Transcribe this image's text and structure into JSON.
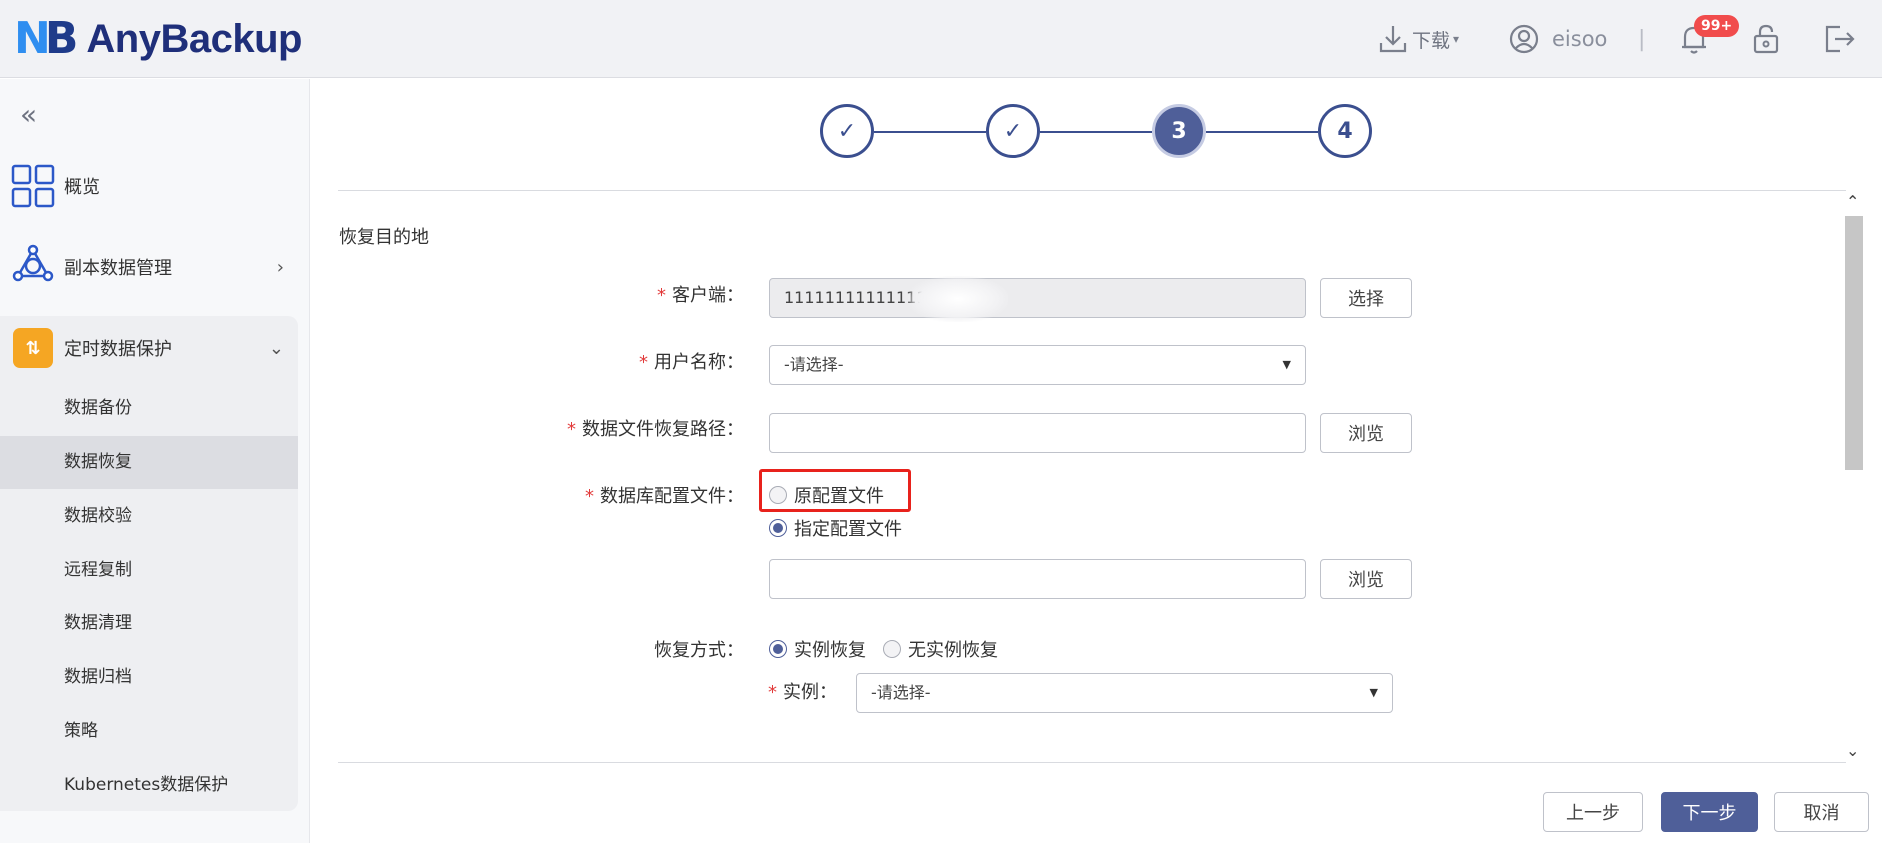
{
  "header": {
    "brand": "AnyBackup",
    "download_label": "下载",
    "username": "eisoo",
    "separator": "|",
    "notification_count": "99+"
  },
  "sidebar": {
    "collapse_glyph": "«",
    "items": [
      {
        "label": "概览",
        "icon": "overview-grid-icon"
      },
      {
        "label": "副本数据管理",
        "icon": "copy-data-network-icon"
      },
      {
        "label": "定时数据保护",
        "icon": "scheduled-protection-icon"
      }
    ],
    "sub_items": [
      "数据备份",
      "数据恢复",
      "数据校验",
      "远程复制",
      "数据清理",
      "数据归档",
      "策略",
      "Kubernetes数据保护"
    ],
    "active_sub_item": "数据恢复"
  },
  "stepper": {
    "steps": [
      "✓",
      "✓",
      "3",
      "4"
    ],
    "current_step": 3
  },
  "form": {
    "section_title": "恢复目的地",
    "client_label": "客户端：",
    "client_value": "11111111111111",
    "select_button": "选择",
    "username_label": "用户名称：",
    "username_placeholder": "-请选择-",
    "datafile_path_label": "数据文件恢复路径：",
    "browse_button": "浏览",
    "config_label": "数据库配置文件：",
    "config_option_original": "原配置文件",
    "config_option_specified": "指定配置文件",
    "config_selected": "指定配置文件",
    "restore_mode_label": "恢复方式：",
    "restore_mode_instance": "实例恢复",
    "restore_mode_no_instance": "无实例恢复",
    "restore_mode_selected": "实例恢复",
    "instance_label": "实例：",
    "instance_placeholder": "-请选择-"
  },
  "footer": {
    "prev_button": "上一步",
    "next_button": "下一步",
    "cancel_button": "取消"
  },
  "colors": {
    "primary": "#4f5f99",
    "required": "#e23b3b",
    "highlight_box": "#e8221c",
    "badge": "#f14c4c",
    "menu_icon_orange": "#f5a623"
  }
}
